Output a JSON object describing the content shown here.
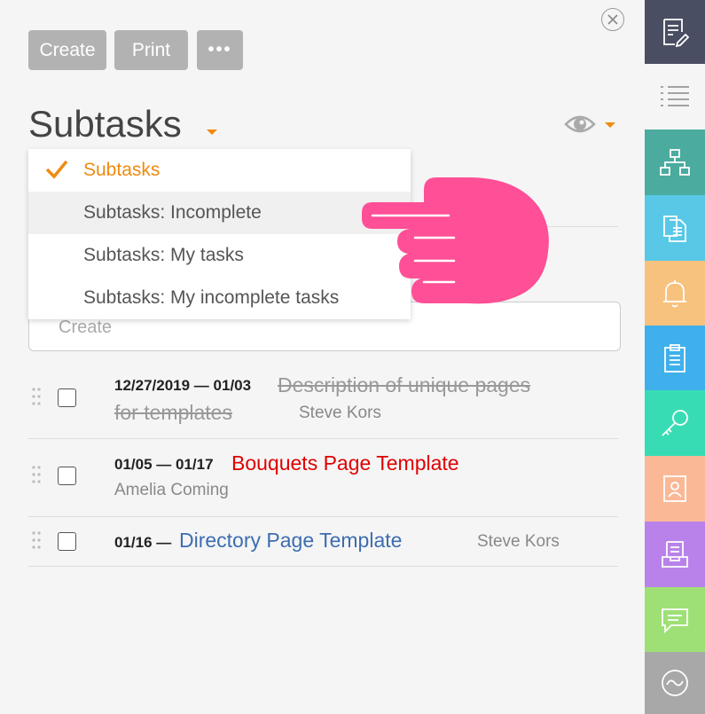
{
  "toolbar": {
    "create_label": "Create",
    "print_label": "Print",
    "more_label": "•••"
  },
  "panel": {
    "title": "Subtasks",
    "create_placeholder": "Create"
  },
  "filter_menu": {
    "options": [
      "Subtasks",
      "Subtasks: Incomplete",
      "Subtasks: My tasks",
      "Subtasks: My incomplete tasks"
    ],
    "selected": "Subtasks",
    "hovered": "Subtasks: Incomplete"
  },
  "tasks": [
    {
      "dates": "12/27/2019 — 01/03",
      "title_line1": "Description of unique pages",
      "title_line2": "for templates",
      "assignee": "Steve Kors",
      "status": "completed",
      "color": "#999999"
    },
    {
      "dates": "01/05 — 01/17",
      "title": "Bouquets Page Template",
      "assignee": "Amelia Coming",
      "status": "overdue",
      "color": "#e00000"
    },
    {
      "dates": "01/16 —",
      "title": "Directory Page Template",
      "assignee": "Steve Kors",
      "status": "open",
      "color": "#3d6db0"
    }
  ],
  "sidebar": [
    {
      "icon": "edit-document-icon",
      "color": "#4a4e62"
    },
    {
      "icon": "list-icon",
      "color": "#f5f5f5"
    },
    {
      "icon": "hierarchy-icon",
      "color": "#4aab9e"
    },
    {
      "icon": "documents-icon",
      "color": "#58c8e6"
    },
    {
      "icon": "bell-icon",
      "color": "#f7c27e"
    },
    {
      "icon": "clipboard-icon",
      "color": "#3fb0ec"
    },
    {
      "icon": "key-icon",
      "color": "#38dcb4"
    },
    {
      "icon": "contact-card-icon",
      "color": "#fbb896"
    },
    {
      "icon": "inbox-icon",
      "color": "#b982ea"
    },
    {
      "icon": "chat-icon",
      "color": "#9ee076"
    },
    {
      "icon": "activity-icon",
      "color": "#a8a8a8"
    }
  ],
  "colors": {
    "accent": "#f08a10",
    "pointer": "#ff4f96"
  }
}
